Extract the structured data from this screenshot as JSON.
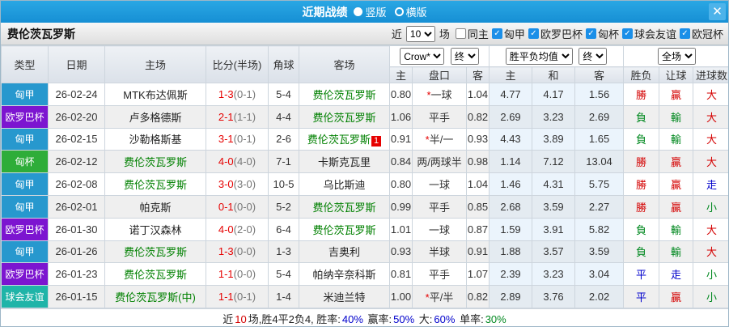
{
  "titlebar": {
    "title": "近期战绩",
    "radio_vertical": "竖版",
    "radio_horizontal": "横版",
    "close_glyph": "✕"
  },
  "filterbar": {
    "team": "费伦茨瓦罗斯",
    "near_label": "近",
    "games_value": "10",
    "games_label": "场",
    "check_glyph": "✓",
    "checkboxes": [
      {
        "label": "同主",
        "checked": false
      },
      {
        "label": "匈甲",
        "checked": true
      },
      {
        "label": "欧罗巴杯",
        "checked": true
      },
      {
        "label": "匈杯",
        "checked": true
      },
      {
        "label": "球会友谊",
        "checked": true
      },
      {
        "label": "欧冠杯",
        "checked": true
      }
    ]
  },
  "table": {
    "headers": {
      "type": "类型",
      "date": "日期",
      "home": "主场",
      "score": "比分(半场)",
      "corner": "角球",
      "away": "客场"
    },
    "dropdowns": {
      "bookmaker": "Crow*",
      "ah_stage": "终",
      "eu_type": "胜平负均值",
      "eu_stage": "终",
      "scope": "全场"
    },
    "subheaders": {
      "ah_home": "主",
      "handicap": "盘口",
      "ah_away": "客",
      "eu_home": "主",
      "eu_draw": "和",
      "eu_away": "客",
      "wl": "胜负",
      "ah_res": "让球",
      "goal_res": "进球数"
    },
    "type_colors": {
      "匈甲": "#2798ce",
      "欧罗巴杯": "#7c15d0",
      "匈杯": "#2ead39",
      "球会友谊": "#1fb4a8"
    },
    "rows": [
      {
        "type": "匈甲",
        "date": "26-02-24",
        "home": "MTK布达佩斯",
        "home_green": false,
        "score": "1-3",
        "half": "(0-1)",
        "corner": "5-4",
        "away": "费伦茨瓦罗斯",
        "away_green": true,
        "away_badge": "",
        "ah_home": "0.80",
        "star": true,
        "handicap": "一球",
        "ah_away": "1.04",
        "eu_home": "4.77",
        "eu_draw": "4.17",
        "eu_away": "1.56",
        "wl": "勝",
        "wl_color": "red",
        "ah_res": "贏",
        "ah_res_color": "red",
        "goal_res": "大",
        "goal_res_color": "red"
      },
      {
        "type": "欧罗巴杯",
        "date": "26-02-20",
        "home": "卢多格德斯",
        "home_green": false,
        "score": "2-1",
        "half": "(1-1)",
        "corner": "4-4",
        "away": "费伦茨瓦罗斯",
        "away_green": true,
        "away_badge": "",
        "ah_home": "1.06",
        "star": false,
        "handicap": "平手",
        "ah_away": "0.82",
        "eu_home": "2.69",
        "eu_draw": "3.23",
        "eu_away": "2.69",
        "wl": "負",
        "wl_color": "green",
        "ah_res": "輸",
        "ah_res_color": "green",
        "goal_res": "大",
        "goal_res_color": "red"
      },
      {
        "type": "匈甲",
        "date": "26-02-15",
        "home": "沙勒格斯基",
        "home_green": false,
        "score": "3-1",
        "half": "(0-1)",
        "corner": "2-6",
        "away": "费伦茨瓦罗斯",
        "away_green": true,
        "away_badge": "1",
        "ah_home": "0.91",
        "star": true,
        "handicap": "半/一",
        "ah_away": "0.93",
        "eu_home": "4.43",
        "eu_draw": "3.89",
        "eu_away": "1.65",
        "wl": "負",
        "wl_color": "green",
        "ah_res": "輸",
        "ah_res_color": "green",
        "goal_res": "大",
        "goal_res_color": "red"
      },
      {
        "type": "匈杯",
        "date": "26-02-12",
        "home": "费伦茨瓦罗斯",
        "home_green": true,
        "score": "4-0",
        "half": "(4-0)",
        "corner": "7-1",
        "away": "卡斯克瓦里",
        "away_green": false,
        "away_badge": "",
        "ah_home": "0.84",
        "star": false,
        "handicap": "两/两球半",
        "ah_away": "0.98",
        "eu_home": "1.14",
        "eu_draw": "7.12",
        "eu_away": "13.04",
        "wl": "勝",
        "wl_color": "red",
        "ah_res": "贏",
        "ah_res_color": "red",
        "goal_res": "大",
        "goal_res_color": "red"
      },
      {
        "type": "匈甲",
        "date": "26-02-08",
        "home": "费伦茨瓦罗斯",
        "home_green": true,
        "score": "3-0",
        "half": "(3-0)",
        "corner": "10-5",
        "away": "乌比斯迪",
        "away_green": false,
        "away_badge": "",
        "ah_home": "0.80",
        "star": false,
        "handicap": "一球",
        "ah_away": "1.04",
        "eu_home": "1.46",
        "eu_draw": "4.31",
        "eu_away": "5.75",
        "wl": "勝",
        "wl_color": "red",
        "ah_res": "贏",
        "ah_res_color": "red",
        "goal_res": "走",
        "goal_res_color": "blue"
      },
      {
        "type": "匈甲",
        "date": "26-02-01",
        "home": "帕克斯",
        "home_green": false,
        "score": "0-1",
        "half": "(0-0)",
        "corner": "5-2",
        "away": "费伦茨瓦罗斯",
        "away_green": true,
        "away_badge": "",
        "ah_home": "0.99",
        "star": false,
        "handicap": "平手",
        "ah_away": "0.85",
        "eu_home": "2.68",
        "eu_draw": "3.59",
        "eu_away": "2.27",
        "wl": "勝",
        "wl_color": "red",
        "ah_res": "贏",
        "ah_res_color": "red",
        "goal_res": "小",
        "goal_res_color": "green"
      },
      {
        "type": "欧罗巴杯",
        "date": "26-01-30",
        "home": "诺丁汉森林",
        "home_green": false,
        "score": "4-0",
        "half": "(2-0)",
        "corner": "6-4",
        "away": "费伦茨瓦罗斯",
        "away_green": true,
        "away_badge": "",
        "ah_home": "1.01",
        "star": false,
        "handicap": "一球",
        "ah_away": "0.87",
        "eu_home": "1.59",
        "eu_draw": "3.91",
        "eu_away": "5.82",
        "wl": "負",
        "wl_color": "green",
        "ah_res": "輸",
        "ah_res_color": "green",
        "goal_res": "大",
        "goal_res_color": "red"
      },
      {
        "type": "匈甲",
        "date": "26-01-26",
        "home": "费伦茨瓦罗斯",
        "home_green": true,
        "score": "1-3",
        "half": "(0-0)",
        "corner": "1-3",
        "away": "吉奥利",
        "away_green": false,
        "away_badge": "",
        "ah_home": "0.93",
        "star": false,
        "handicap": "半球",
        "ah_away": "0.91",
        "eu_home": "1.88",
        "eu_draw": "3.57",
        "eu_away": "3.59",
        "wl": "負",
        "wl_color": "green",
        "ah_res": "輸",
        "ah_res_color": "green",
        "goal_res": "大",
        "goal_res_color": "red"
      },
      {
        "type": "欧罗巴杯",
        "date": "26-01-23",
        "home": "费伦茨瓦罗斯",
        "home_green": true,
        "score": "1-1",
        "half": "(0-0)",
        "corner": "5-4",
        "away": "帕纳辛奈科斯",
        "away_green": false,
        "away_badge": "",
        "ah_home": "0.81",
        "star": false,
        "handicap": "平手",
        "ah_away": "1.07",
        "eu_home": "2.39",
        "eu_draw": "3.23",
        "eu_away": "3.04",
        "wl": "平",
        "wl_color": "blue",
        "ah_res": "走",
        "ah_res_color": "blue",
        "goal_res": "小",
        "goal_res_color": "green"
      },
      {
        "type": "球会友谊",
        "date": "26-01-15",
        "home": "费伦茨瓦罗斯(中)",
        "home_green": true,
        "score": "1-1",
        "half": "(0-1)",
        "corner": "1-4",
        "away": "米迪兰特",
        "away_green": false,
        "away_badge": "",
        "ah_home": "1.00",
        "star": true,
        "handicap": "平/半",
        "ah_away": "0.82",
        "eu_home": "2.89",
        "eu_draw": "3.76",
        "eu_away": "2.02",
        "wl": "平",
        "wl_color": "blue",
        "ah_res": "贏",
        "ah_res_color": "red",
        "goal_res": "小",
        "goal_res_color": "green"
      }
    ]
  },
  "summary": {
    "segments": [
      {
        "text": "近",
        "color": "black"
      },
      {
        "text": "10",
        "color": "red"
      },
      {
        "text": "场,胜4平2负4, 胜率:",
        "color": "black"
      },
      {
        "text": "40%",
        "color": "blue"
      },
      {
        "text": " 赢率:",
        "color": "black"
      },
      {
        "text": "50%",
        "color": "blue"
      },
      {
        "text": " 大:",
        "color": "black"
      },
      {
        "text": "60%",
        "color": "blue"
      },
      {
        "text": " 单率:",
        "color": "black"
      },
      {
        "text": "30%",
        "color": "green"
      }
    ]
  }
}
